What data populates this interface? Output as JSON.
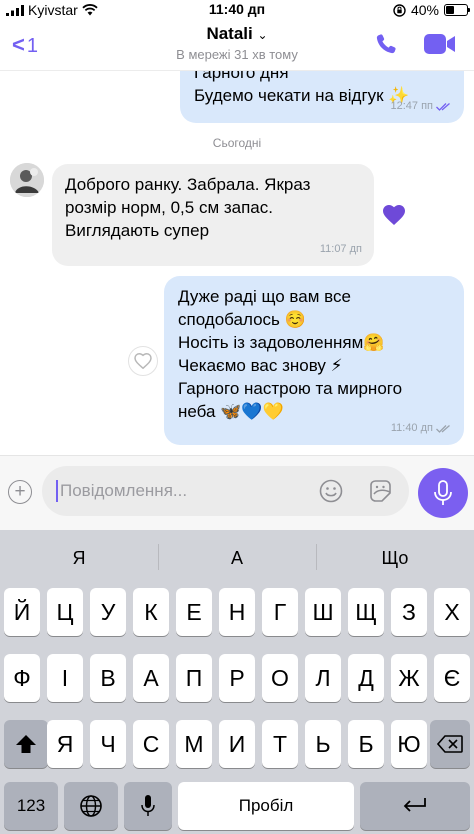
{
  "status_bar": {
    "carrier": "Kyivstar",
    "time": "11:40 дп",
    "battery": "40%",
    "battery_level": 0.4
  },
  "header": {
    "back_count": "1",
    "contact_name": "Natali",
    "contact_status": "В мережі 31 хв тому"
  },
  "messages": {
    "m0": {
      "lines": [
        "Гарного дня",
        "Будемо чекати на відгук ✨"
      ],
      "time": "12:47 пп"
    },
    "divider": "Сьогодні",
    "m1": {
      "lines": [
        "Доброго ранку. Забрала. Якраз",
        "розмір норм, 0,5 см запас.",
        "Виглядають супер"
      ],
      "time": "11:07 дп"
    },
    "m2": {
      "lines": [
        "Дуже раді що вам все",
        "сподобалось ☺️",
        "Носіть із задоволенням🤗",
        "Чекаємо вас знову ⚡",
        "Гарного настрою та мирного",
        "неба 🦋💙💛"
      ],
      "time": "11:40 дп"
    }
  },
  "composer": {
    "placeholder": "Повідомлення..."
  },
  "keyboard": {
    "suggestions": [
      "Я",
      "А",
      "Що"
    ],
    "row1": [
      "Й",
      "Ц",
      "У",
      "К",
      "Е",
      "Н",
      "Г",
      "Ш",
      "Щ",
      "З",
      "Х"
    ],
    "row2": [
      "Ф",
      "І",
      "В",
      "А",
      "П",
      "Р",
      "О",
      "Л",
      "Д",
      "Ж",
      "Є"
    ],
    "row3": [
      "Я",
      "Ч",
      "С",
      "М",
      "И",
      "Т",
      "Ь",
      "Б",
      "Ю"
    ],
    "numbers_label": "123",
    "space_label": "Пробіл"
  },
  "colors": {
    "accent": "#7360f2",
    "outgoing_bubble": "#d9e8fb",
    "incoming_bubble": "#efefef"
  }
}
